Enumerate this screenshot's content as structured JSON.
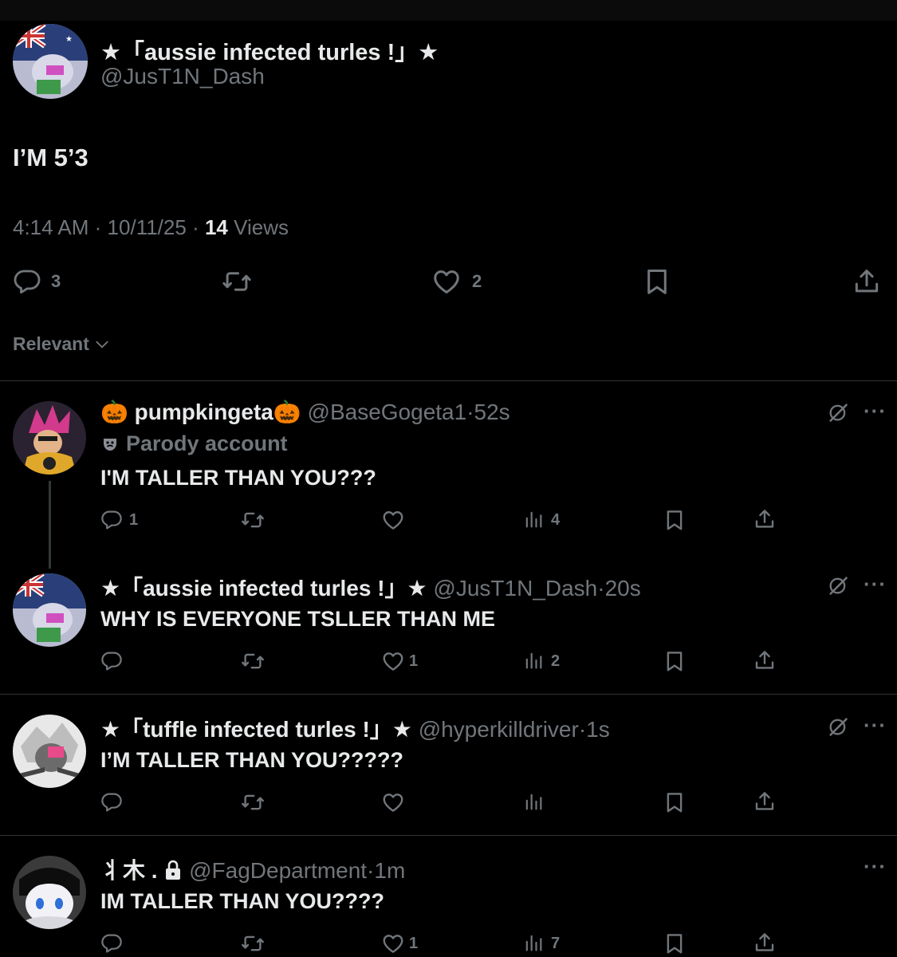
{
  "main_post": {
    "display_name": "★「aussie infected turles !」★",
    "handle": "@JusT1N_Dash",
    "text": "I’M 5’3",
    "time": "4:14 AM",
    "date": "10/11/25",
    "views_count": "14",
    "views_label": "Views",
    "reply_count": "3",
    "like_count": "2"
  },
  "sort_label": "Relevant",
  "replies": [
    {
      "display_name": "🎃 pumpkingeta🎃",
      "handle": "@BaseGogeta1",
      "time": "52s",
      "badge": "Parody account",
      "text": "I'M TALLER THAN YOU???",
      "reply_count": "1",
      "like_count": "",
      "views_count": "4"
    },
    {
      "display_name": "★「aussie infected turles !」★",
      "handle": "@JusT1N_Dash",
      "time": "20s",
      "text": "WHY IS EVERYONE TSLLER THAN ME",
      "reply_count": "",
      "like_count": "1",
      "views_count": "2"
    },
    {
      "display_name": "★「tuffle infected turles !」★",
      "handle": "@hyperkilldriver",
      "time": "1s",
      "text": "I’M TALLER THAN YOU?????",
      "reply_count": "",
      "like_count": "",
      "views_count": ""
    },
    {
      "display_name": "⺦⽊ .",
      "handle": "@FagDepartment",
      "time": "1m",
      "text": "IM TALLER THAN YOU????",
      "reply_count": "",
      "like_count": "1",
      "views_count": "7"
    }
  ],
  "separator": "·",
  "more_label": "···",
  "icons": [
    "reply-icon",
    "repost-icon",
    "like-icon",
    "views-icon",
    "bookmark-icon",
    "share-icon",
    "grok-icon",
    "lock-icon",
    "theater-mask-icon",
    "chevron-down-icon"
  ],
  "colors": {
    "background": "#000000",
    "text": "#e7e9ea",
    "secondary": "#71767b",
    "divider": "#2f3336"
  }
}
